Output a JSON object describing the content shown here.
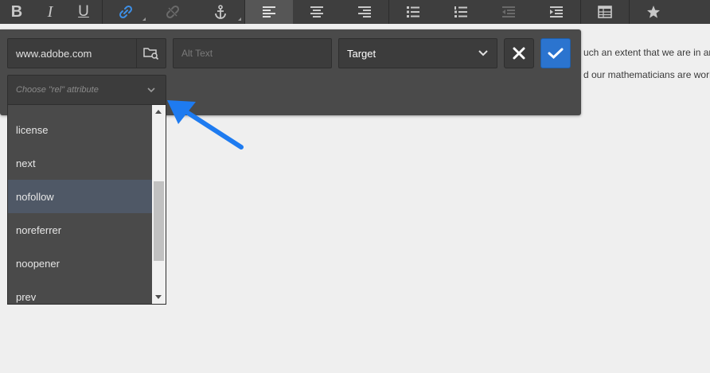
{
  "toolbar": {
    "buttons": [
      {
        "name": "bold",
        "glyph": "B"
      },
      {
        "name": "italic",
        "glyph": "I"
      },
      {
        "name": "underline",
        "glyph": "U"
      }
    ]
  },
  "background_text": {
    "line1": "uch an extent that we are in an",
    "line2": "d our mathematicians are worki"
  },
  "link_dialog": {
    "url_value": "www.adobe.com",
    "alt_text_placeholder": "Alt Text",
    "target_label": "Target",
    "rel_placeholder": "Choose \"rel\" attribute"
  },
  "rel_options": [
    "license",
    "next",
    "nofollow",
    "noreferrer",
    "noopener",
    "prev"
  ],
  "colors": {
    "toolbar_bg": "#3e3e3e",
    "panel_bg": "#4a4a4a",
    "confirm_blue": "#2b74cf",
    "link_icon_blue": "#3d8fe6",
    "pointer_arrow": "#1e7bf0",
    "hover_row": "#4f5866"
  }
}
